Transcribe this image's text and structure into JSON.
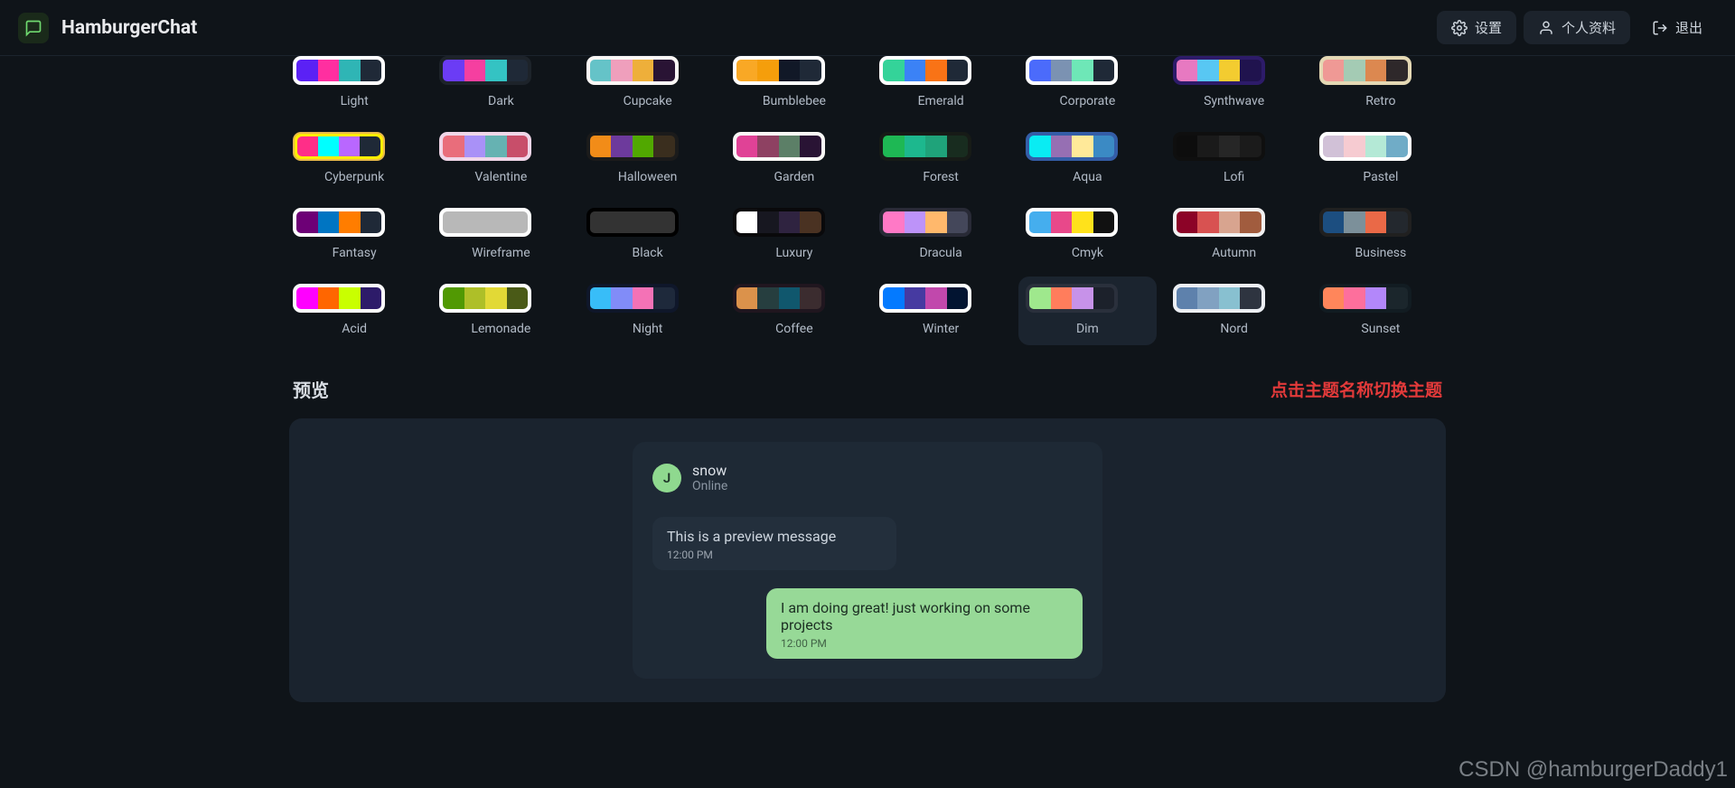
{
  "brand": "HamburgerChat",
  "top": {
    "settings": "设置",
    "profile": "个人资料",
    "logout": "退出"
  },
  "themes": [
    {
      "name": "Light",
      "bg": "#ffffff",
      "c": [
        "#5b21f5",
        "#ff2fa0",
        "#2fb5b5",
        "#1f2937"
      ]
    },
    {
      "name": "Dark",
      "bg": "#1d232a",
      "c": [
        "#6b3cf5",
        "#f53fa0",
        "#34c3c3",
        "#1f2937"
      ]
    },
    {
      "name": "Cupcake",
      "bg": "#faf7f5",
      "c": [
        "#65c3c8",
        "#ef9fbc",
        "#eeaf3a",
        "#291334"
      ]
    },
    {
      "name": "Bumblebee",
      "bg": "#ffffff",
      "c": [
        "#f9a825",
        "#f59e0b",
        "#111827",
        "#1f2937"
      ]
    },
    {
      "name": "Emerald",
      "bg": "#ffffff",
      "c": [
        "#34d399",
        "#3b82f6",
        "#f97316",
        "#1f2937"
      ]
    },
    {
      "name": "Corporate",
      "bg": "#ffffff",
      "c": [
        "#4b6bfb",
        "#7b92b2",
        "#6ee7b7",
        "#1f2937"
      ]
    },
    {
      "name": "Synthwave",
      "bg": "#2d1b69",
      "c": [
        "#e779c1",
        "#58c7f3",
        "#f3cc30",
        "#20134e"
      ]
    },
    {
      "name": "Retro",
      "bg": "#e4d8b4",
      "c": [
        "#ef9995",
        "#a4cbb4",
        "#dc8850",
        "#2e282a"
      ]
    },
    {
      "name": "Cyberpunk",
      "bg": "#ffee00",
      "c": [
        "#ff2e88",
        "#00ffff",
        "#b967ff",
        "#1f2937"
      ],
      "active_border": true
    },
    {
      "name": "Valentine",
      "bg": "#f0d6e8",
      "c": [
        "#e96d7b",
        "#a991f7",
        "#66b2b2",
        "#c84e6a"
      ]
    },
    {
      "name": "Halloween",
      "bg": "#1b1b1b",
      "c": [
        "#f28c18",
        "#6d3a9c",
        "#51a800",
        "#3a2e1e"
      ]
    },
    {
      "name": "Garden",
      "bg": "#f9f8f6",
      "c": [
        "#e04296",
        "#8e4162",
        "#5c7f67",
        "#291334"
      ]
    },
    {
      "name": "Forest",
      "bg": "#171b17",
      "c": [
        "#1eb854",
        "#1db88e",
        "#1fa37a",
        "#182c1f"
      ]
    },
    {
      "name": "Aqua",
      "bg": "#345da7",
      "c": [
        "#09ecf3",
        "#966fb3",
        "#ffe999",
        "#3b8ac4"
      ]
    },
    {
      "name": "Lofi",
      "bg": "#0f0f0f",
      "c": [
        "#0d0d0d",
        "#1a1a1a",
        "#262626",
        "#1b1b1b"
      ]
    },
    {
      "name": "Pastel",
      "bg": "#ffffff",
      "c": [
        "#d1c1d7",
        "#f6cbd1",
        "#b4e9d6",
        "#70acc7"
      ]
    },
    {
      "name": "Fantasy",
      "bg": "#ffffff",
      "c": [
        "#6d0076",
        "#0075c2",
        "#ff7d00",
        "#1f2937"
      ]
    },
    {
      "name": "Wireframe",
      "bg": "#ffffff",
      "c": [
        "#b8b8b8",
        "#b8b8b8",
        "#b8b8b8",
        "#b8b8b8"
      ]
    },
    {
      "name": "Black",
      "bg": "#000000",
      "c": [
        "#333333",
        "#333333",
        "#333333",
        "#333333"
      ]
    },
    {
      "name": "Luxury",
      "bg": "#09090b",
      "c": [
        "#ffffff",
        "#171720",
        "#2f2340",
        "#4a3222"
      ]
    },
    {
      "name": "Dracula",
      "bg": "#282a36",
      "c": [
        "#ff79c6",
        "#bd93f9",
        "#ffb86c",
        "#44475a"
      ]
    },
    {
      "name": "Cmyk",
      "bg": "#ffffff",
      "c": [
        "#45aeee",
        "#e8488a",
        "#ffe21b",
        "#111111"
      ]
    },
    {
      "name": "Autumn",
      "bg": "#f1f1f1",
      "c": [
        "#8c0327",
        "#d85251",
        "#d8a48f",
        "#a15c3e"
      ]
    },
    {
      "name": "Business",
      "bg": "#202020",
      "c": [
        "#1c4e80",
        "#7c909a",
        "#ea6947",
        "#23282e"
      ]
    },
    {
      "name": "Acid",
      "bg": "#fafafa",
      "c": [
        "#ff00ff",
        "#ff6600",
        "#c9ff00",
        "#2d1b69"
      ]
    },
    {
      "name": "Lemonade",
      "bg": "#ffffff",
      "c": [
        "#519903",
        "#aebf28",
        "#e2d936",
        "#4a5a17"
      ]
    },
    {
      "name": "Night",
      "bg": "#0f172a",
      "c": [
        "#38bdf8",
        "#818cf8",
        "#f472b6",
        "#1e293b"
      ]
    },
    {
      "name": "Coffee",
      "bg": "#20161f",
      "c": [
        "#db924b",
        "#263e3f",
        "#10576d",
        "#3b2c2f"
      ]
    },
    {
      "name": "Winter",
      "bg": "#ffffff",
      "c": [
        "#047aff",
        "#463aa1",
        "#c148ac",
        "#021431"
      ]
    },
    {
      "name": "Dim",
      "bg": "#2a303c",
      "c": [
        "#9fe88d",
        "#ff7d5c",
        "#c792e9",
        "#1c212b"
      ],
      "active": true
    },
    {
      "name": "Nord",
      "bg": "#eceff4",
      "c": [
        "#5e81ac",
        "#81a1c1",
        "#88c0d0",
        "#2e3440"
      ]
    },
    {
      "name": "Sunset",
      "bg": "#121c22",
      "c": [
        "#ff865b",
        "#fd6f9c",
        "#b387fa",
        "#1b262c"
      ]
    }
  ],
  "section": {
    "preview_label": "预览",
    "hint": "点击主题名称切换主题"
  },
  "preview": {
    "avatar_letter": "J",
    "username": "snow",
    "status": "Online",
    "msg1": "This is a preview message",
    "time1": "12:00 PM",
    "msg2": "I am doing great! just working on some projects",
    "time2": "12:00 PM"
  },
  "watermark": "CSDN @hamburgerDaddy1"
}
